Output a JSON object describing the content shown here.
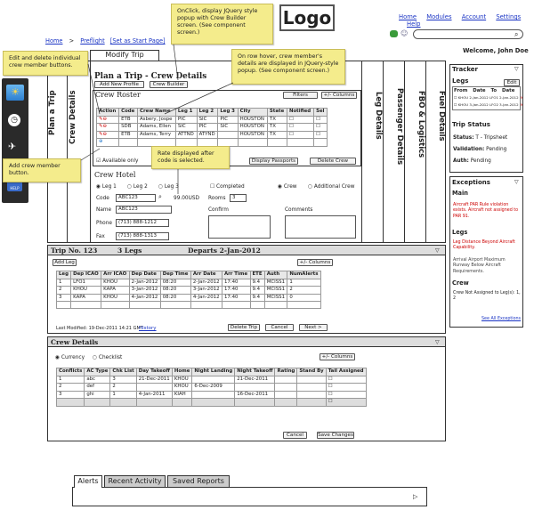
{
  "logo": "Logo",
  "topnav": [
    "Home",
    "Modules",
    "Account",
    "Settings",
    "Help"
  ],
  "welcome": "Welcome, John Doe",
  "breadcrumb": {
    "home": "Home",
    "preflight": "Preflight",
    "set_start": "[Set as Start Page]"
  },
  "modify_trip": "Modify Trip",
  "notes": {
    "jquery_popup": "OnClick, display JQuery style popup with Crew Builder screen. (See component screen.)",
    "hover": "On row hover, crew member's details are displayed in JQuery-style popup. (See component screen.)",
    "edit_delete": "Edit and delete individual crew member buttons.",
    "add_crew": "Add crew member button.",
    "rate": "Rate displayed after code is selected."
  },
  "vtabs": {
    "plan": "Plan a Trip",
    "crew": "Crew Details",
    "leg": "Leg Details",
    "passenger": "Passenger Details",
    "fbo": "FBO & Logistics",
    "fuel": "Fuel Details"
  },
  "crew_panel": {
    "title": "Plan a Trip - Crew Details",
    "add_new_profile": "Add New Profile",
    "crew_builder": "Crew Builder",
    "roster": "Crew Roster",
    "filters": "Filters",
    "columns": "+/- Columns",
    "headers": [
      "Action",
      "Code",
      "Crew Name",
      "Leg 1",
      "Leg 2",
      "Leg 3",
      "City",
      "State",
      "Notified",
      "Sel"
    ],
    "rows": [
      [
        "ETB",
        "Asbery, Jospe",
        "PIC",
        "SIC",
        "PIC",
        "HOUSTON",
        "TX"
      ],
      [
        "SDB",
        "Adams, Ellen",
        "SIC",
        "PIC",
        "SIC",
        "HOUSTON",
        "TX"
      ],
      [
        "ETB",
        "Adams, Terry",
        "ATTND",
        "ATYND",
        "",
        "HOUSTON",
        "TX"
      ]
    ],
    "available_only": "Available only",
    "display_passports": "Display Passports",
    "delete_crew": "Delete Crew"
  },
  "hotel": {
    "title": "Crew Hotel",
    "leg1": "Leg 1",
    "leg2": "Leg 2",
    "leg3": "Leg 3",
    "completed": "Completed",
    "crew": "Crew",
    "additional_crew": "Additional Crew",
    "code_lbl": "Code",
    "code": "ABC123",
    "rate": "99.00USD",
    "rooms_lbl": "Rooms",
    "rooms": "3",
    "name_lbl": "Name",
    "name": "ABC123",
    "confirm_lbl": "Confirm",
    "comments_lbl": "Comments",
    "phone_lbl": "Phone",
    "phone": "(713) 888-1212",
    "fax_lbl": "Fax",
    "fax": "(713) 888-1313"
  },
  "trip": {
    "title": "Trip No. 123",
    "legs": "3 Legs",
    "departs": "Departs 2-Jan-2012",
    "add_leg": "Add Leg",
    "columns": "+/- Columns",
    "headers": [
      "Leg",
      "Dep ICAO",
      "Arr ICAO",
      "Dep Date",
      "Dep Time",
      "Arr Date",
      "Arr Time",
      "ETE",
      "Auth",
      "NumAlerts"
    ],
    "rows": [
      [
        "1",
        "LFO1",
        "KHOU",
        "2-Jan-2012",
        "08:20",
        "2-Jan-2012",
        "17:40",
        "9.4",
        "MCISS1",
        "1"
      ],
      [
        "2",
        "KHOU",
        "KAPA",
        "3-Jan-2012",
        "08:20",
        "3-Jan-2012",
        "17:40",
        "9.4",
        "MCISS1",
        "2"
      ],
      [
        "3",
        "KAPA",
        "KHOU",
        "4-Jan-2012",
        "08:20",
        "4-Jan-2012",
        "17:40",
        "9.4",
        "MCISS1",
        "0"
      ]
    ],
    "last_modified": "Last Modified: 19-Dec-2011 14:21 GMT",
    "history": "History",
    "delete_trip": "Delete Trip",
    "cancel": "Cancel",
    "next": "Next >"
  },
  "crew_details": {
    "title": "Crew Details",
    "currency": "Currency",
    "checklist": "Checklist",
    "columns": "+/- Columns",
    "headers": [
      "Conflicts",
      "AC Type",
      "Chk List",
      "Day Takeoff",
      "Home",
      "Night Landing",
      "Night Takeoff",
      "Rating",
      "Stand By",
      "Tail Assigned"
    ],
    "rows": [
      [
        "1",
        "abc",
        "3",
        "21-Dec-2011",
        "KHOU",
        "",
        "21-Dec-2011"
      ],
      [
        "2",
        "def",
        "2",
        "",
        "KHOU",
        "6-Dec-2009",
        ""
      ],
      [
        "3",
        "ghi",
        "1",
        "4-Jan-2011",
        "KIAH",
        "",
        "16-Dec-2011"
      ]
    ],
    "cancel": "Cancel",
    "save": "Save Changes"
  },
  "tracker": {
    "title": "Tracker",
    "legs": "Legs",
    "edit": "Edit",
    "from": "From",
    "date": "Date",
    "to": "To",
    "to_date": "Date",
    "legrows": [
      "KHOU 2-Jan-2012 LFO1 2-Jan-2012",
      "KHOU 3-Jan-2012 LFO2 3-Jan-2012"
    ],
    "trip_status": "Trip Status",
    "status_lbl": "Status:",
    "status": "T - Tripsheet",
    "validation_lbl": "Validation:",
    "validation": "Pending",
    "auth_lbl": "Auth:",
    "auth": "Pending"
  },
  "exceptions": {
    "title": "Exceptions",
    "main": "Main",
    "main_msg": "Aircraft PAR Rule violation exists. Aircraft not assigned to PAR 91.",
    "legs": "Legs",
    "legs_msg1": "Leg Distance Beyond Aircraft Capability.",
    "legs_msg2": "Arrival Airport Maximum Runway Below Aircraft Requirements.",
    "crew": "Crew",
    "crew_msg": "Crew Not Assigned to Leg(s): 1, 2",
    "see_all": "See All Exceptions"
  },
  "bottom_tabs": [
    "Alerts",
    "Recent Activity",
    "Saved Reports"
  ],
  "search_placeholder": "",
  "colors": {
    "sticky": "#f4ec8c",
    "link": "#1a34c4",
    "red": "#c00",
    "sidebar": "#2a2a2a"
  }
}
